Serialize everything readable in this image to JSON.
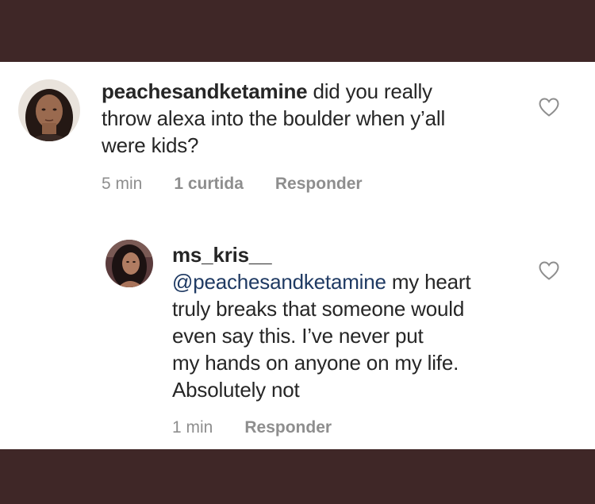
{
  "comment": {
    "username": "peachesandketamine",
    "text_lines": [
      "did you really",
      "throw alexa into the boulder when y’all",
      "were kids?"
    ],
    "time": "5 min",
    "likes": "1 curtida",
    "reply_label": "Responder",
    "heart_icon": "heart-outline-icon"
  },
  "reply": {
    "username": "ms_kris__",
    "mention": "@peachesandketamine",
    "text_lines": [
      "my heart",
      "truly breaks that someone would",
      "even say this.  I’ve never put",
      "my hands on anyone on my life.",
      "Absolutely not"
    ],
    "time": "1 min",
    "reply_label": "Responder",
    "heart_icon": "heart-outline-icon"
  },
  "colors": {
    "frame": "#3f2727",
    "text": "#262626",
    "meta": "#8e8e8e",
    "mention": "#1f3a63"
  }
}
